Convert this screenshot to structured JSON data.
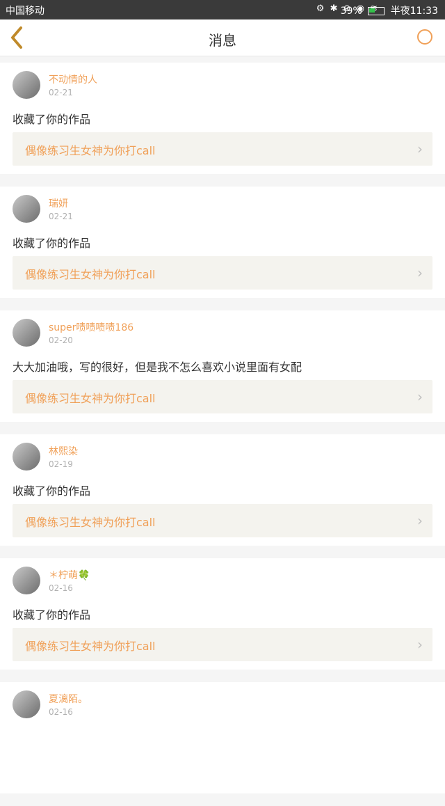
{
  "status": {
    "carrier": "中国移动",
    "icons": "⚙ ✱ ⊘ ◉ ≋",
    "battery": "39%",
    "time": "半夜11:33"
  },
  "nav": {
    "title": "消息"
  },
  "messages": [
    {
      "name": "不动情的人",
      "date": "02-21",
      "comment": "收藏了你的作品",
      "work": "偶像练习生女神为你打call"
    },
    {
      "name": "瑞妍",
      "date": "02-21",
      "comment": "收藏了你的作品",
      "work": "偶像练习生女神为你打call"
    },
    {
      "name": "super啧啧啧啧186",
      "date": "02-20",
      "comment": "大大加油哦，写的很好，但是我不怎么喜欢小说里面有女配",
      "work": "偶像练习生女神为你打call"
    },
    {
      "name": "林熙染",
      "date": "02-19",
      "comment": "收藏了你的作品",
      "work": "偶像练习生女神为你打call"
    },
    {
      "name": "＊柠萌🍀",
      "date": "02-16",
      "comment": "收藏了你的作品",
      "work": "偶像练习生女神为你打call"
    },
    {
      "name": "夏漓陌。",
      "date": "02-16",
      "comment": "",
      "work": ""
    }
  ],
  "colors": {
    "accent": "#f0a058",
    "background": "#f5f5f5"
  }
}
